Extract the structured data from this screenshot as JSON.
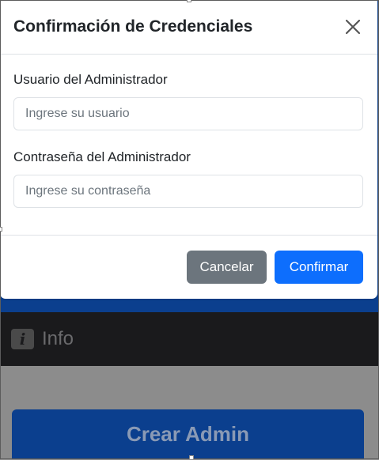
{
  "modal": {
    "title": "Confirmación de Credenciales",
    "close_icon": "close-x-icon",
    "username": {
      "label": "Usuario del Administrador",
      "placeholder": "Ingrese su usuario",
      "value": ""
    },
    "password": {
      "label": "Contraseña del Administrador",
      "placeholder": "Ingrese su contraseña",
      "value": ""
    },
    "cancel_label": "Cancelar",
    "confirm_label": "Confirmar"
  },
  "background": {
    "info_icon": "info-icon",
    "info_label": "Info",
    "create_admin_label": "Crear Admin"
  },
  "colors": {
    "primary": "#0d6efd",
    "secondary": "#6c757d",
    "backdrop": "#8c8c8c",
    "navbar_blue": "#0b3f8e",
    "info_bar": "#1a1a1c"
  }
}
